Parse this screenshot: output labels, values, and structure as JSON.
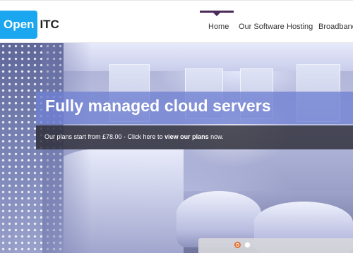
{
  "brand": {
    "logo_box_text": "Open",
    "logo_text": "ITC",
    "accent_color": "#1aa7f0"
  },
  "nav": {
    "items": [
      {
        "label": "Home",
        "active": true
      },
      {
        "label": "Our Software",
        "active": false
      },
      {
        "label": "Hosting",
        "active": false
      },
      {
        "label": "Broadband",
        "active": false
      }
    ],
    "active_indicator_color": "#4b2a5a"
  },
  "hero": {
    "title": "Fully managed cloud servers",
    "subtitle_prefix": "Our plans start from £78.00 - Click here to ",
    "subtitle_link": "view our plans",
    "subtitle_suffix": " now.",
    "title_bg_color": "#7080d2",
    "subtitle_bg_color": "#2d2d37"
  },
  "slider": {
    "slide_count": 2,
    "active_index": 0,
    "active_dot_color": "#e46d2a"
  }
}
